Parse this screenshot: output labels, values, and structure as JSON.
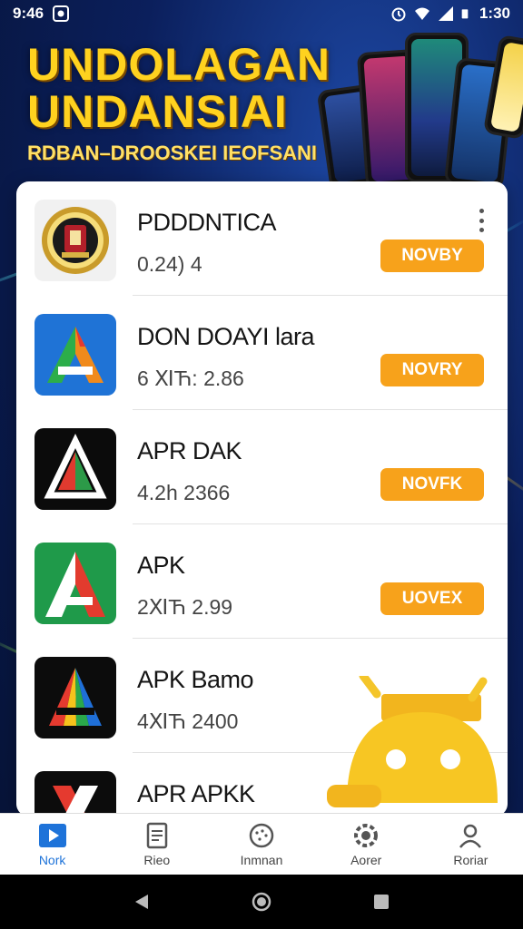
{
  "status_bar": {
    "time": "9:46",
    "right_time": "1:30"
  },
  "hero": {
    "title_line1": "UNDOLAGAN",
    "title_line2": "UNDANSIAI",
    "subtitle": "RDBAN–DROOSKEI IEOFSANI"
  },
  "apps": [
    {
      "name": "PDDDNTICA",
      "meta": "0.24) 4",
      "button": "NOVBY",
      "icon": "emblem-badge-icon"
    },
    {
      "name": "DON DOAYI lara",
      "meta": "6 ⅪЋ: 2.86",
      "button": "NOVRY",
      "icon": "multicolor-a-icon"
    },
    {
      "name": "APR DAK",
      "meta": "4.2h 2366",
      "button": "NOVFK",
      "icon": "black-a-icon"
    },
    {
      "name": "APK",
      "meta": "2ⅪЋ 2.99",
      "button": "UOVEX",
      "icon": "green-red-a-icon"
    },
    {
      "name": "APK Bamo",
      "meta": "4ⅪЋ 2400",
      "button": "",
      "icon": "rainbow-a-icon"
    },
    {
      "name": "APR APKK",
      "meta": "",
      "button": "",
      "icon": "red-x-icon"
    }
  ],
  "bottom_nav": [
    {
      "label": "Nork",
      "icon": "play-store-icon",
      "active": true
    },
    {
      "label": "Rieo",
      "icon": "document-icon",
      "active": false
    },
    {
      "label": "Inmnan",
      "icon": "dotted-circle-icon",
      "active": false
    },
    {
      "label": "Aorer",
      "icon": "gear-icon",
      "active": false
    },
    {
      "label": "Roriar",
      "icon": "person-icon",
      "active": false
    }
  ],
  "colors": {
    "accent_button": "#f7a21b",
    "nav_active": "#1e73d9",
    "hero_yellow": "#ffd21f"
  }
}
